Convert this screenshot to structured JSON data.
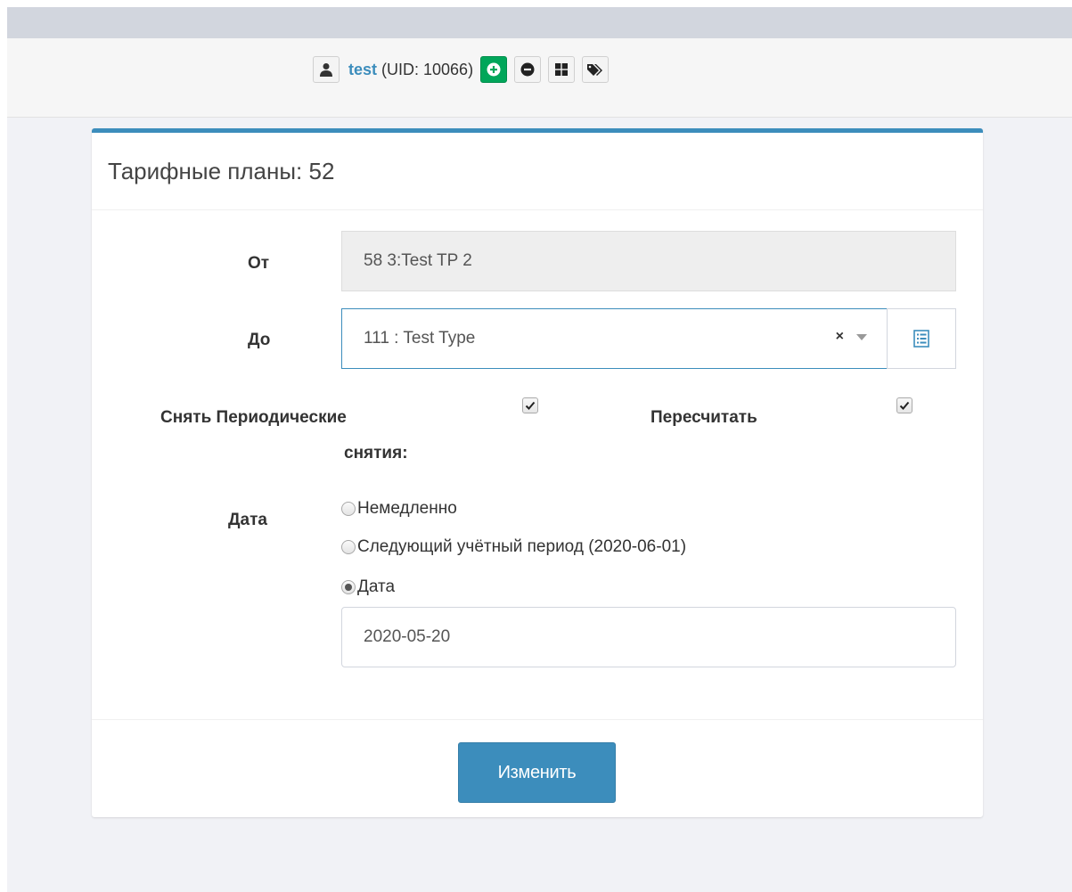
{
  "user_bar": {
    "user_name": "test",
    "uid_text": "(UID: 10066)"
  },
  "panel": {
    "title": "Тарифные планы: 52",
    "from_label": "От",
    "from_value": "58 3:Test TP 2",
    "to_label": "До",
    "to_value": "111 : Test Type",
    "clear_symbol": "×",
    "remove_periodic_label_line1": "Снять Периодические",
    "remove_periodic_label_line2": "снятия:",
    "remove_periodic_checked": true,
    "recalculate_label": "Пересчитать",
    "recalculate_checked": true,
    "date_label": "Дата",
    "date_options": [
      {
        "label": "Немедленно",
        "selected": false
      },
      {
        "label": "Следующий учётный период (2020-06-01)",
        "selected": false
      },
      {
        "label": "Дата",
        "selected": true
      }
    ],
    "date_value": "2020-05-20",
    "submit_label": "Изменить"
  },
  "colors": {
    "accent": "#3c8dbc",
    "success": "#00a65a"
  }
}
